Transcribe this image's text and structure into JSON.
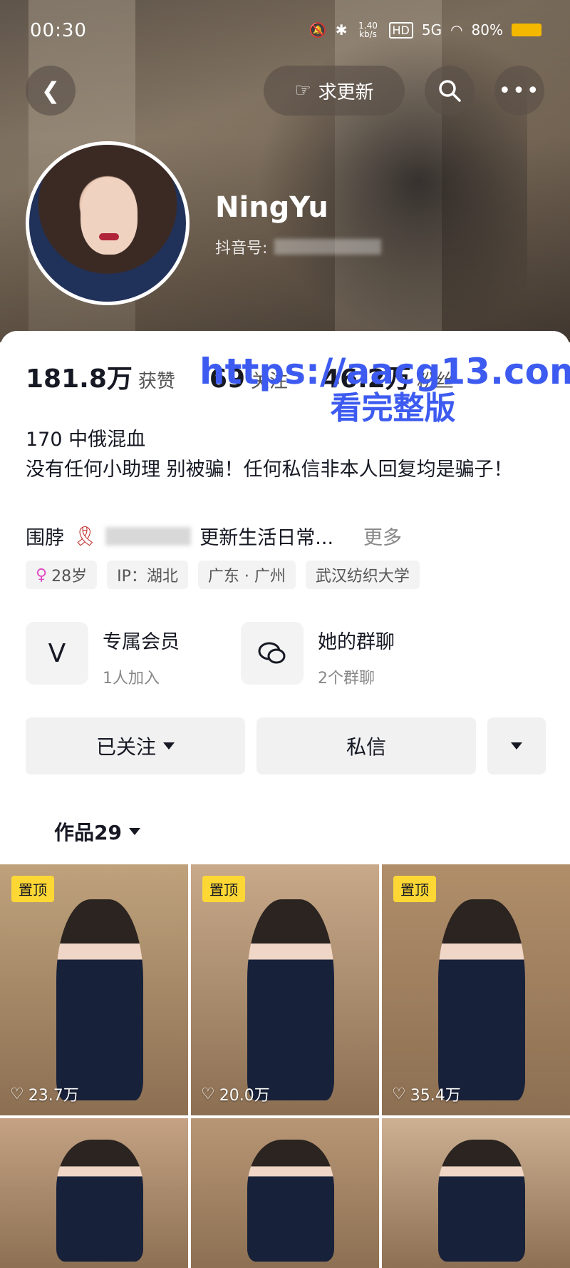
{
  "status_bar": {
    "time": "00:30",
    "speed": "1.40 kb/s",
    "hd": "HD",
    "network": "5G",
    "battery": "80%"
  },
  "nav": {
    "request_update_label": "求更新"
  },
  "profile": {
    "nickname": "NingYu",
    "douyin_id_label": "抖音号:"
  },
  "stats": [
    {
      "value": "181.8万",
      "label": "获赞"
    },
    {
      "value": "69",
      "label": "关注"
    },
    {
      "value": "46.2万",
      "label": "粉丝"
    }
  ],
  "watermark": {
    "url": "https://aacg13.com",
    "sub": "看完整版"
  },
  "bio": {
    "line1": "170 中俄混血",
    "line2": "没有任何小助理 别被骗！任何私信非本人回复均是骗子！",
    "line4_prefix": "围脖",
    "line4_suffix": "更新生活日常...",
    "more": "更多"
  },
  "tags": [
    "28岁",
    "IP：湖北",
    "广东 · 广州",
    "武汉纺织大学"
  ],
  "features": {
    "member": {
      "title": "专属会员",
      "sub": "1人加入"
    },
    "group": {
      "title": "她的群聊",
      "sub": "2个群聊"
    }
  },
  "actions": {
    "follow": "已关注",
    "message": "私信"
  },
  "works_tab": "作品29",
  "videos": [
    {
      "pinned": "置顶",
      "likes": "23.7万",
      "bg": "#bfa27c"
    },
    {
      "pinned": "置顶",
      "likes": "20.0万",
      "bg": "#c8a98a"
    },
    {
      "pinned": "置顶",
      "likes": "35.4万",
      "bg": "#b08e6a"
    },
    {
      "pinned": "",
      "likes": "",
      "bg": "#c4a283"
    },
    {
      "pinned": "",
      "likes": "",
      "bg": "#b79674"
    },
    {
      "pinned": "",
      "likes": "",
      "bg": "#cdb092"
    }
  ]
}
